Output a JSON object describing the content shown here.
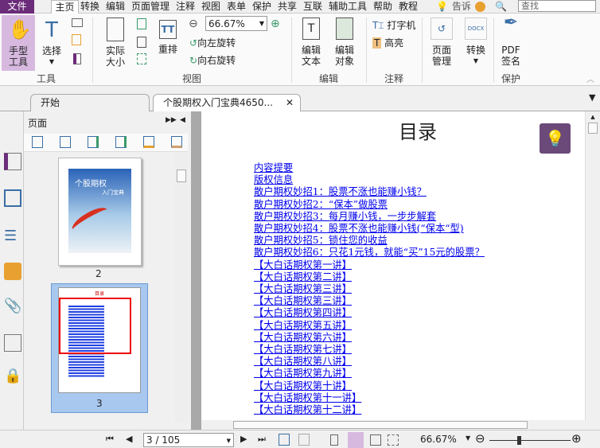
{
  "menu": {
    "file": "文件",
    "items": [
      "主页",
      "转换",
      "编辑",
      "页面管理",
      "注释",
      "视图",
      "表单",
      "保护",
      "共享",
      "互联",
      "辅助工具",
      "帮助",
      "教程"
    ],
    "tell": "告诉",
    "search_placeholder": "查找"
  },
  "ribbon": {
    "hand": "手型\n工具",
    "select": "选择",
    "actual": "实际\n大小",
    "reflow": "重排",
    "zoom_value": "66.67%",
    "rotate_left": "向左旋转",
    "rotate_right": "向右旋转",
    "edit_text": "编辑\n文本",
    "edit_object": "编辑\n对象",
    "typewriter": "打字机",
    "highlight": "高亮",
    "page_manage": "页面\n管理",
    "convert": "转换",
    "pdf_sign": "PDF\n签名",
    "groups": {
      "tools": "工具",
      "view": "视图",
      "edit": "编辑",
      "annotate": "注释",
      "protect": "保护"
    }
  },
  "tabs": [
    {
      "label": "开始"
    },
    {
      "label": "个股期权入门宝典4650..."
    }
  ],
  "panel": {
    "title": "页面",
    "thumbs": [
      {
        "label": "2",
        "cover_title": "个股期权",
        "cover_sub": "入门宝典"
      },
      {
        "label": "3",
        "mini_title": "目录"
      }
    ]
  },
  "document": {
    "title": "目录",
    "links": [
      "内容提要",
      "版权信息",
      "散户期权妙招1：股票不涨也能赚小钱？",
      "散户期权妙招2：“保本”做股票",
      "散户期权妙招3：每月赚小钱，一步步解套",
      "散户期权妙招4：股票不涨也能赚小钱(“保本“型)",
      "散户期权妙招5：锁住您的收益",
      "散户期权妙招6：只花1元钱，就能“买”15元的股票？",
      "【大白话期权第一讲】",
      "【大白话期权第二讲】",
      "【大白话期权第三讲】",
      "【大白话期权第三讲】",
      "【大白话期权第四讲】",
      "【大白话期权第五讲】",
      "【大白话期权第六讲】",
      "【大白话期权第七讲】",
      "【大白话期权第八讲】",
      "【大白话期权第九讲】",
      "【大白话期权第十讲】",
      "【大白话期权第十一讲】",
      "【大白话期权第十二讲】"
    ]
  },
  "status": {
    "page": "3 / 105",
    "zoom": "66.67%"
  },
  "colors": {
    "accent": "#6b2c7a",
    "link": "#0000ee",
    "selected_thumb": "#a8c8f0"
  }
}
